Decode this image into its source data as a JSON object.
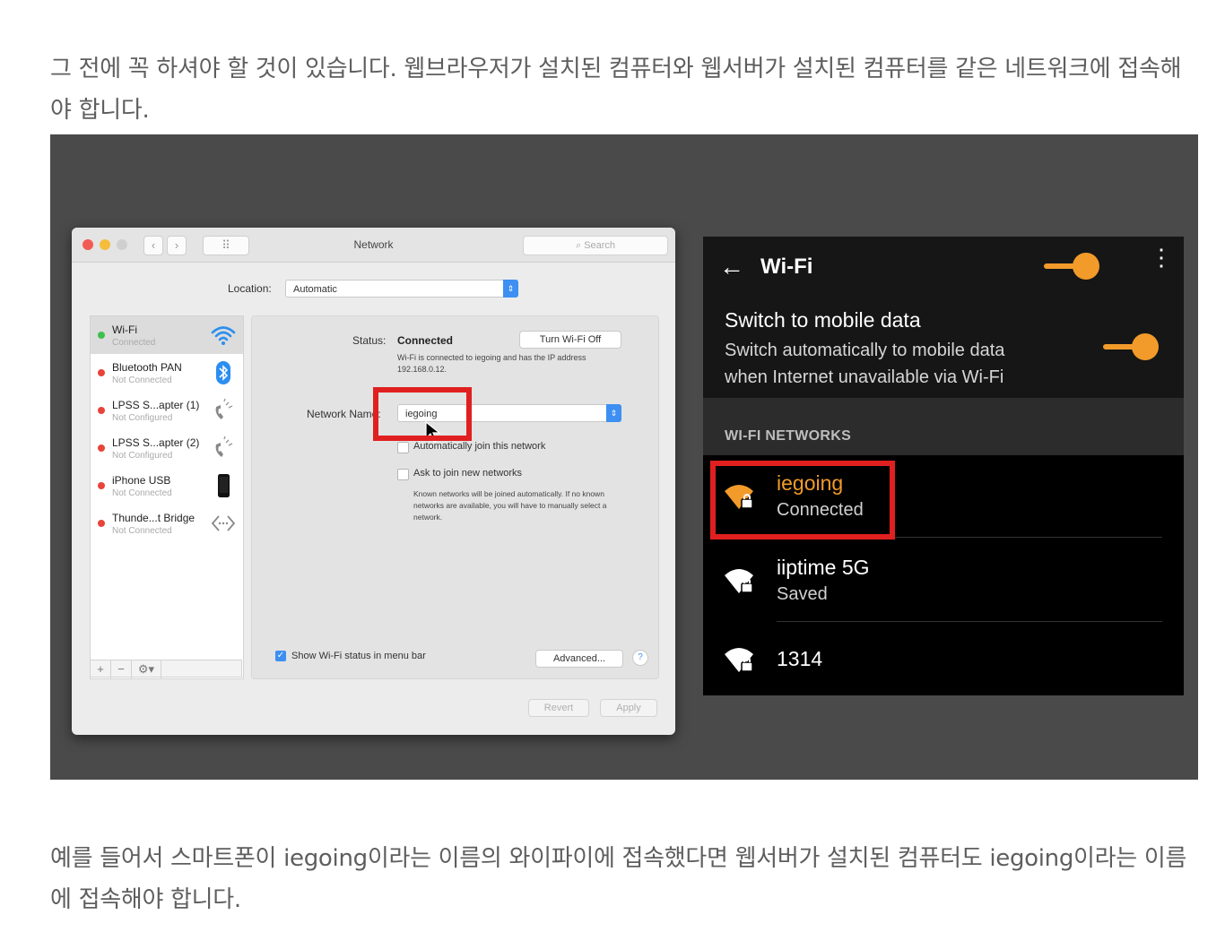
{
  "intro_paragraph": "그 전에 꼭 하셔야 할 것이 있습니다. 웹브라우저가 설치된 컴퓨터와 웹서버가 설치된 컴퓨터를 같은 네트워크에 접속해야 합니다.",
  "outro_paragraph": "예를 들어서 스마트폰이 iegoing이라는 이름의 와이파이에 접속했다면 웹서버가 설치된 컴퓨터도 iegoing이라는 이름에 접속해야 합니다.",
  "mac": {
    "window_title": "Network",
    "search_placeholder": "Search",
    "nav_back": "‹",
    "nav_forward": "›",
    "grid_glyph": "⠿",
    "location_label": "Location:",
    "location_value": "Automatic",
    "services": [
      {
        "name": "Wi-Fi",
        "status": "Connected",
        "dot_color": "#3dc14b",
        "icon": "wifi-icon"
      },
      {
        "name": "Bluetooth PAN",
        "status": "Not Connected",
        "dot_color": "#e8443a",
        "icon": "bluetooth-icon"
      },
      {
        "name": "LPSS S...apter (1)",
        "status": "Not Configured",
        "dot_color": "#e8443a",
        "icon": "phone-handset-icon"
      },
      {
        "name": "LPSS S...apter (2)",
        "status": "Not Configured",
        "dot_color": "#e8443a",
        "icon": "phone-handset-icon"
      },
      {
        "name": "iPhone USB",
        "status": "Not Connected",
        "dot_color": "#e8443a",
        "icon": "iphone-icon"
      },
      {
        "name": "Thunde...t Bridge",
        "status": "Not Connected",
        "dot_color": "#e8443a",
        "icon": "bridge-arrows-icon"
      }
    ],
    "sidebar_footer": {
      "add": "+",
      "remove": "−",
      "action": "⚙▾"
    },
    "status_label": "Status:",
    "status_value": "Connected",
    "turn_off_button": "Turn Wi-Fi Off",
    "status_description": "Wi-Fi is connected to iegoing and has the IP address 192.168.0.12.",
    "network_name_label": "Network Name:",
    "network_name_value": "iegoing",
    "auto_join_label": "Automatically join this network",
    "ask_join_label": "Ask to join new networks",
    "ask_join_description": "Known networks will be joined automatically. If no known networks are available, you will have to manually select a network.",
    "show_status_label": "Show Wi-Fi status in menu bar",
    "advanced_button": "Advanced...",
    "help_button": "?",
    "revert_button": "Revert",
    "apply_button": "Apply"
  },
  "android": {
    "title": "Wi-Fi",
    "back_glyph": "←",
    "more_glyph": "⋮",
    "accent_color": "#f29b2a",
    "wifi_toggle_on": true,
    "mobile_data_title": "Switch to mobile data",
    "mobile_data_subtitle": "Switch automatically to mobile data when Internet unavailable via Wi-Fi",
    "mobile_data_toggle_on": true,
    "section_label": "WI-FI NETWORKS",
    "networks": [
      {
        "name": "iegoing",
        "status": "Connected",
        "name_color": "#f29b2a"
      },
      {
        "name": "iiptime 5G",
        "status": "Saved",
        "name_color": "#ffffff"
      },
      {
        "name": "1314",
        "status": "",
        "name_color": "#ffffff"
      }
    ]
  },
  "highlight_color": "#e02020"
}
